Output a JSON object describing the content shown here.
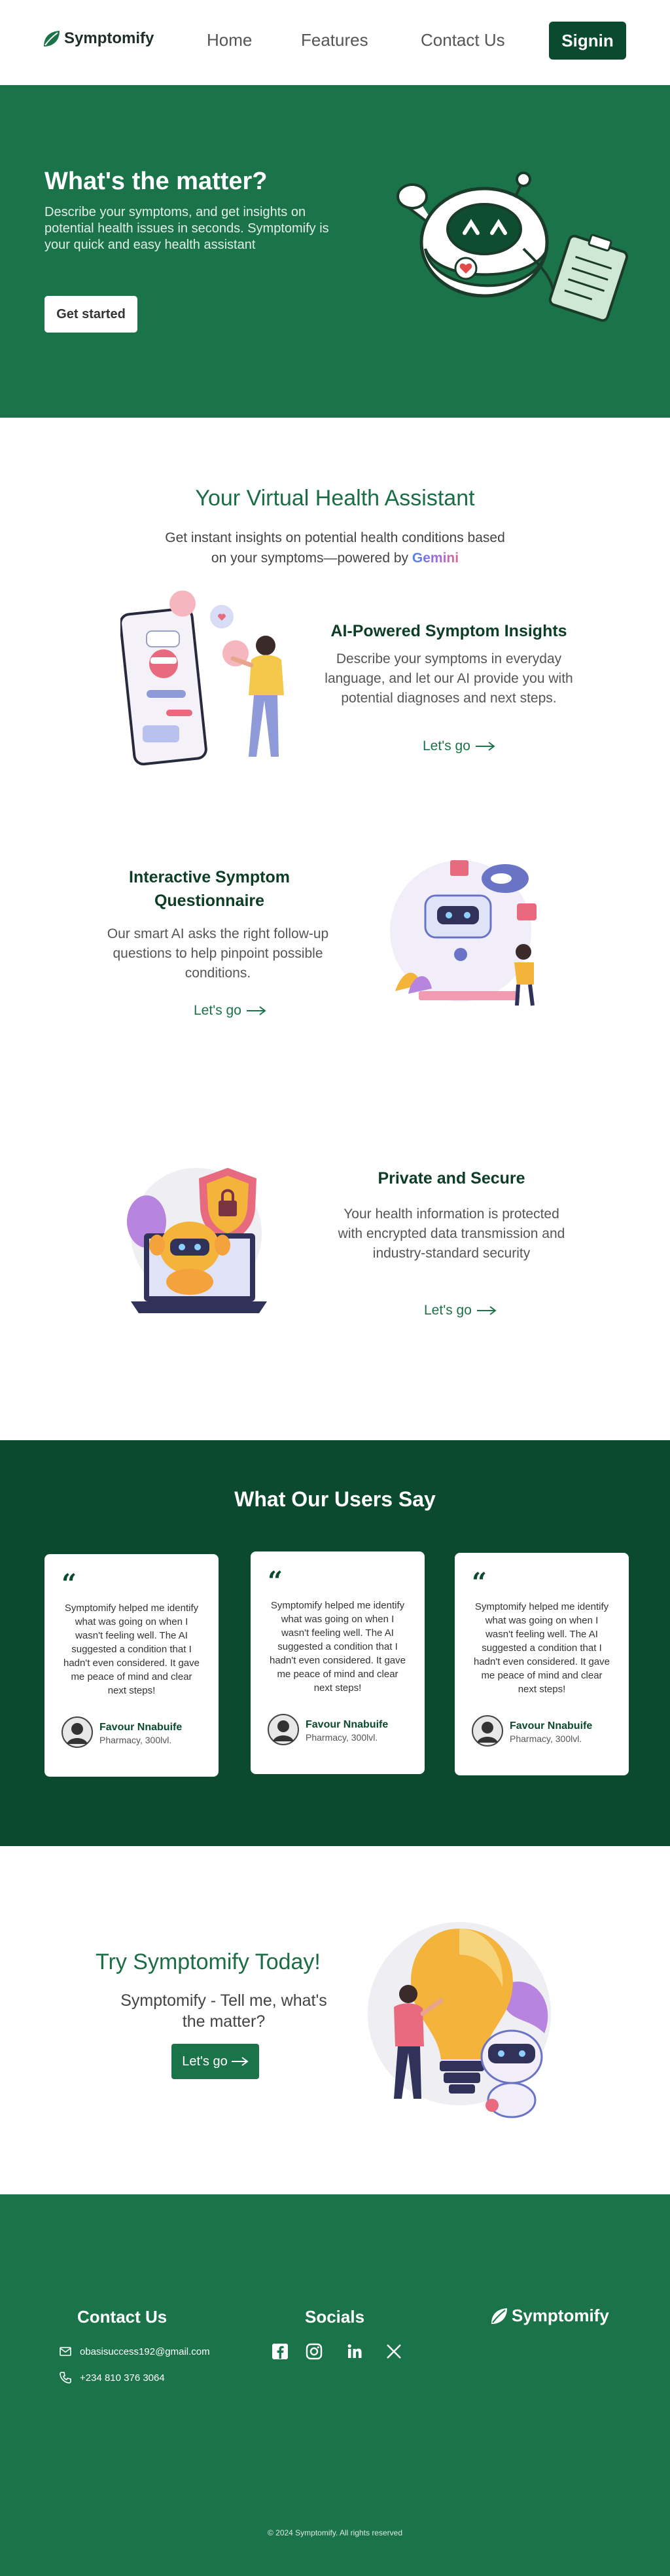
{
  "nav": {
    "logo_text": "Symptomify",
    "links": [
      "Home",
      "Features",
      "Contact Us"
    ],
    "signin_label": "Signin"
  },
  "hero": {
    "title": "What's the matter?",
    "description": "Describe your symptoms, and get insights on potential health issues in seconds. Symptomify is your quick and easy health assistant",
    "cta_label": "Get started"
  },
  "assistant": {
    "title": "Your Virtual Health Assistant",
    "subtitle_line1": "Get instant insights on potential health conditions based",
    "subtitle_line2": "on your symptoms—powered by",
    "brand": "Gemini"
  },
  "features": [
    {
      "title": "AI-Powered Symptom Insights",
      "description": "Describe your symptoms in everyday language, and let our AI provide you with potential diagnoses and next steps.",
      "link": "Let's go"
    },
    {
      "title": "Interactive Symptom Questionnaire",
      "description": "Our smart AI asks the right follow-up questions to help pinpoint possible conditions.",
      "link": "Let's go"
    },
    {
      "title": "Private and Secure",
      "description": "Your health information is protected with encrypted data transmission and industry-standard security",
      "link": "Let's go"
    }
  ],
  "testimonials": {
    "title": "What Our Users Say",
    "items": [
      {
        "quote": "Symptomify helped me identify what was going on when I wasn't feeling well. The AI suggested a condition that I hadn't even considered. It gave me peace of mind and clear next steps!",
        "name": "Favour Nnabuife",
        "role": "Pharmacy, 300lvl."
      },
      {
        "quote": "Symptomify helped me identify what was going on when I wasn't feeling well. The AI suggested a condition that I hadn't even considered. It gave me peace of mind and clear next steps!",
        "name": "Favour Nnabuife",
        "role": "Pharmacy, 300lvl."
      },
      {
        "quote": "Symptomify helped me identify what was going on when I wasn't feeling well. The AI suggested a condition that I hadn't even considered. It gave me peace of mind and clear next steps!",
        "name": "Favour Nnabuife",
        "role": "Pharmacy, 300lvl."
      }
    ]
  },
  "cta": {
    "title": "Try Symptomify Today!",
    "subtitle": "Symptomify - Tell me, what's the matter?",
    "button_label": "Let's go"
  },
  "footer": {
    "contact_heading": "Contact Us",
    "email": "obasisuccess192@gmail.com",
    "phone": "+234 810 376 3064",
    "socials_heading": "Socials",
    "socials": [
      "facebook-icon",
      "instagram-icon",
      "linkedin-icon",
      "x-icon"
    ],
    "logo_text": "Symptomify",
    "copyright": "© 2024 Symptomify. All rights reserved"
  },
  "colors": {
    "brand_green": "#1b734a",
    "dark_green": "#0b4a2e",
    "accent_pink": "#e86a7e"
  }
}
